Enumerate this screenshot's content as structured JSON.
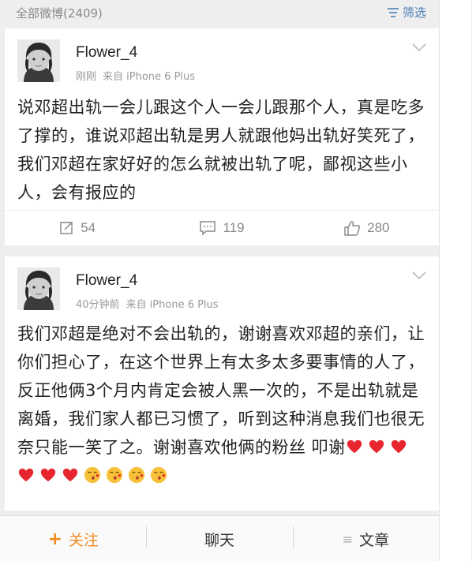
{
  "header": {
    "weibo_count": "全部微博(2409)",
    "filter_label": "筛选"
  },
  "posts": [
    {
      "author": "Flower_4",
      "time": "刚刚",
      "source": "来自 iPhone 6 Plus",
      "text": "说邓超出轨一会儿跟这个人一会儿跟那个人，真是吃多了撑的，谁说邓超出轨是男人就跟他妈出轨好笑死了，我们邓超在家好好的怎么就被出轨了呢，鄙视这些小人，会有报应的",
      "reposts": "54",
      "comments": "119",
      "likes": "280"
    },
    {
      "author": "Flower_4",
      "time": "40分钟前",
      "source": "来自 iPhone 6 Plus",
      "text": "我们邓超是绝对不会出轨的，谢谢喜欢邓超的亲们，让你们担心了，在这个世界上有太多太多要事情的人了，反正他俩3个月内肯定会被人黑一次的，不是出轨就是离婚，我们家人都已习惯了，听到这种消息我们也很无奈只能一笑了之。谢谢喜欢他俩的粉丝 叩谢",
      "emojis": [
        "heart",
        "heart",
        "heart",
        "heart",
        "heart",
        "heart",
        "kiss-face",
        "kiss-face",
        "kiss-face",
        "kiss-face"
      ]
    }
  ],
  "bottom_bar": {
    "follow": "关注",
    "chat": "聊天",
    "article": "文章"
  },
  "colors": {
    "accent_orange": "#f08b26",
    "link_blue": "#4a7fb8",
    "heart_red": "#e8262f"
  }
}
